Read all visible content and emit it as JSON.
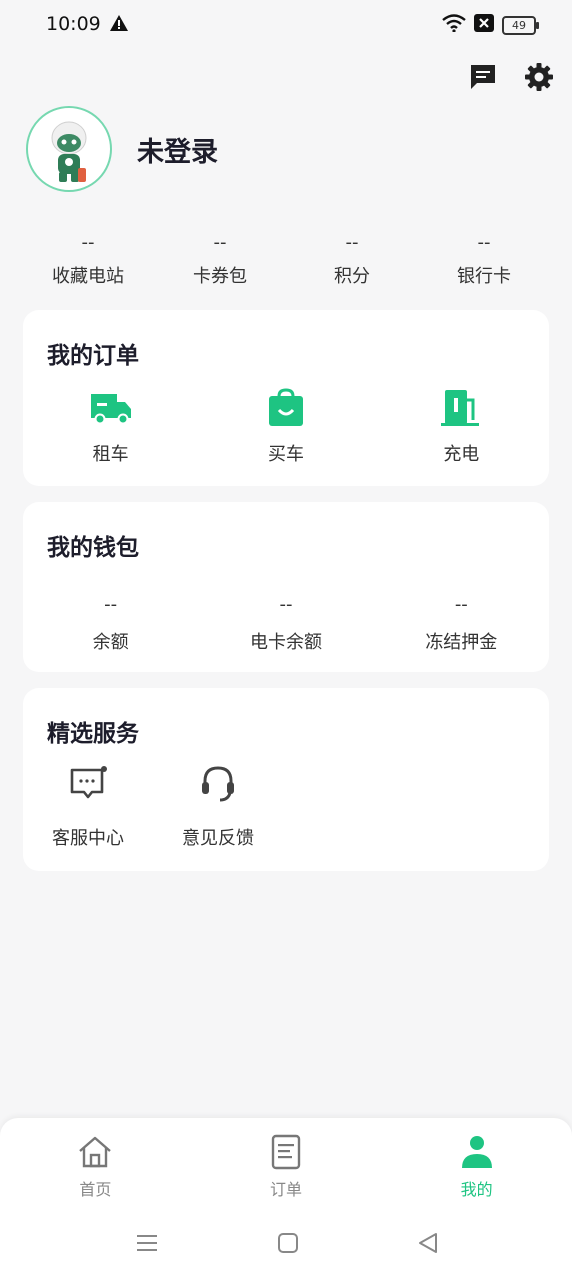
{
  "status_bar": {
    "time": "10:09",
    "battery": "49"
  },
  "profile": {
    "name": "未登录"
  },
  "stats": [
    {
      "value": "--",
      "label": "收藏电站"
    },
    {
      "value": "--",
      "label": "卡券包"
    },
    {
      "value": "--",
      "label": "积分"
    },
    {
      "value": "--",
      "label": "银行卡"
    }
  ],
  "orders": {
    "title": "我的订单",
    "items": [
      {
        "label": "租车",
        "icon": "truck-icon"
      },
      {
        "label": "买车",
        "icon": "shopping-bag-icon"
      },
      {
        "label": "充电",
        "icon": "charging-station-icon"
      }
    ]
  },
  "wallet": {
    "title": "我的钱包",
    "items": [
      {
        "value": "--",
        "label": "余额"
      },
      {
        "value": "--",
        "label": "电卡余额"
      },
      {
        "value": "--",
        "label": "冻结押金"
      }
    ]
  },
  "services": {
    "title": "精选服务",
    "items": [
      {
        "label": "客服中心",
        "icon": "chat-bubble-icon"
      },
      {
        "label": "意见反馈",
        "icon": "headset-icon"
      }
    ]
  },
  "tabbar": {
    "items": [
      {
        "label": "首页",
        "icon": "home-icon"
      },
      {
        "label": "订单",
        "icon": "document-icon"
      },
      {
        "label": "我的",
        "icon": "person-icon"
      }
    ],
    "active_index": 2
  },
  "colors": {
    "accent": "#1ec482",
    "background": "#f6f6f7",
    "card": "#ffffff"
  }
}
